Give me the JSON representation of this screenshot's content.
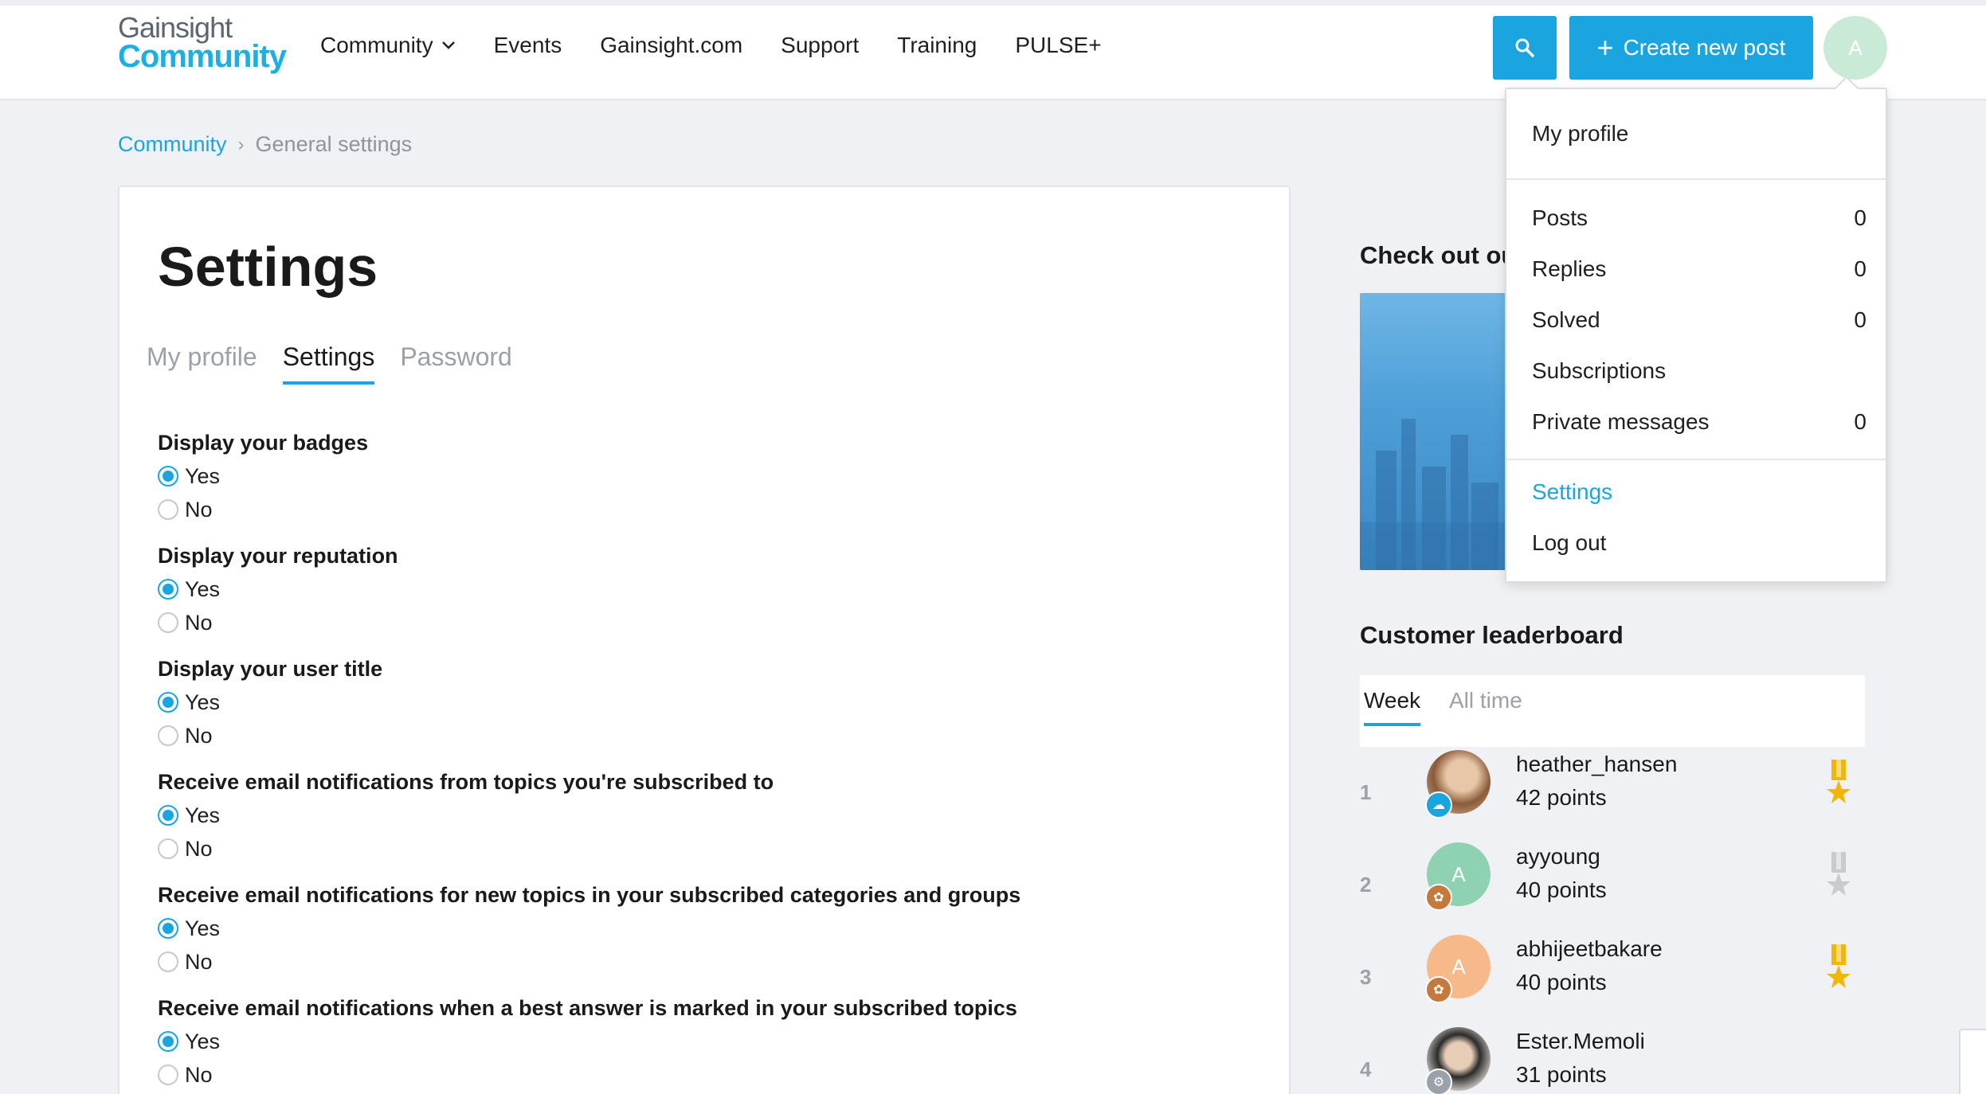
{
  "header": {
    "logo_line1": "Gainsight",
    "logo_line2": "Community",
    "nav": [
      {
        "label": "Community"
      },
      {
        "label": "Events"
      },
      {
        "label": "Gainsight.com"
      },
      {
        "label": "Support"
      },
      {
        "label": "Training"
      },
      {
        "label": "PULSE+"
      }
    ],
    "create_label": "Create new post",
    "avatar_initial": "A"
  },
  "breadcrumb": {
    "root": "Community",
    "separator": "›",
    "current": "General settings"
  },
  "main": {
    "title": "Settings",
    "tabs": [
      {
        "label": "My profile"
      },
      {
        "label": "Settings"
      },
      {
        "label": "Password"
      }
    ],
    "settings": [
      {
        "label": "Display your badges",
        "selected": "Yes"
      },
      {
        "label": "Display your reputation",
        "selected": "Yes"
      },
      {
        "label": "Display your user title",
        "selected": "Yes"
      },
      {
        "label": "Receive email notifications from topics you're subscribed to",
        "selected": "Yes"
      },
      {
        "label": "Receive email notifications for new topics in your subscribed categories and groups",
        "selected": "Yes"
      },
      {
        "label": "Receive email notifications when a best answer is marked in your subscribed topics",
        "selected": "Yes"
      }
    ],
    "option_yes": "Yes",
    "option_no": "No"
  },
  "sidebar": {
    "featured_title": "Check out ou",
    "leaderboard_title": "Customer leaderboard",
    "leaderboard_tabs": [
      {
        "label": "Week"
      },
      {
        "label": "All time"
      }
    ],
    "leaderboard": [
      {
        "rank": "1",
        "name": "heather_hansen",
        "points": "42 points",
        "avatar_color": "#b98a63",
        "initial": "",
        "medal": "gold"
      },
      {
        "rank": "2",
        "name": "ayyoung",
        "points": "40 points",
        "avatar_color": "#8fd2b2",
        "initial": "A",
        "medal": "silver"
      },
      {
        "rank": "3",
        "name": "abhijeetbakare",
        "points": "40 points",
        "avatar_color": "#f7b98a",
        "initial": "A",
        "medal": "gold"
      },
      {
        "rank": "4",
        "name": "Ester.Memoli",
        "points": "31 points",
        "avatar_color": "#e8e2dd",
        "initial": "",
        "medal": ""
      }
    ]
  },
  "user_menu": {
    "profile": "My profile",
    "items": [
      {
        "label": "Posts",
        "count": "0"
      },
      {
        "label": "Replies",
        "count": "0"
      },
      {
        "label": "Solved",
        "count": "0"
      },
      {
        "label": "Subscriptions",
        "count": ""
      },
      {
        "label": "Private messages",
        "count": "0"
      }
    ],
    "settings": "Settings",
    "logout": "Log out"
  },
  "colors": {
    "accent": "#1ba5e0",
    "gold_medal": "#f2b705",
    "silver_medal": "#c8ccd1"
  }
}
